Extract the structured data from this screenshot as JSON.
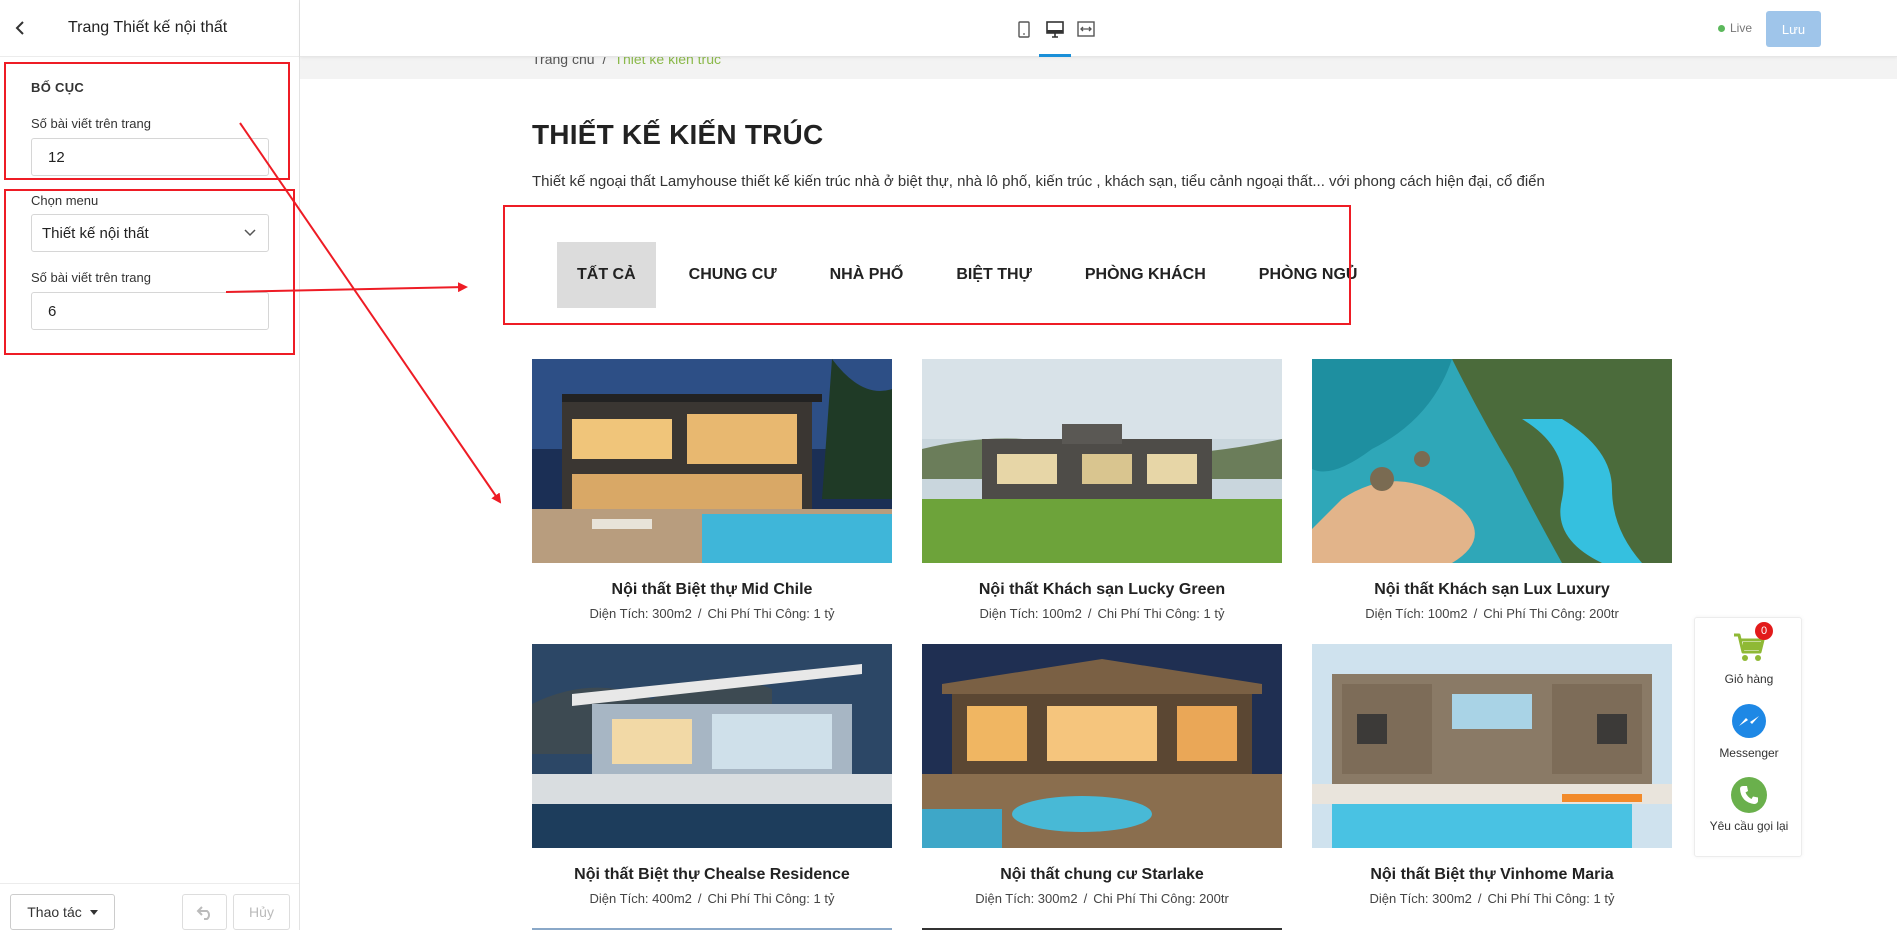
{
  "sidebar": {
    "title": "Trang Thiết kế nội thất",
    "section": "BỐ CỤC",
    "label_posts1": "Số bài viết trên trang",
    "posts1": "12",
    "label_menu": "Chọn menu",
    "menu_value": "Thiết kế nội thất",
    "label_posts2": "Số bài viết trên trang",
    "posts2": "6",
    "actions_label": "Thao tác",
    "cancel_label": "Hủy"
  },
  "topbar": {
    "live_label": "Live",
    "save_label": "Lưu"
  },
  "page": {
    "breadcrumb_home": "Trang chủ",
    "breadcrumb_sep": "/",
    "breadcrumb_current": "Thiết kế kiến trúc",
    "title": "THIẾT KẾ KIẾN TRÚC",
    "description": "Thiết kế ngoại thất Lamyhouse thiết kế kiến trúc nhà ở biệt thự, nhà lô phố, kiến trúc , khách sạn, tiểu cảnh ngoại thất... với phong cách hiện đại, cổ điển",
    "tabs": [
      "TẤT CẢ",
      "CHUNG CƯ",
      "NHÀ PHỐ",
      "BIỆT THỰ",
      "PHÒNG KHÁCH",
      "PHÒNG NGỦ"
    ],
    "meta_sep": "/",
    "cards": [
      {
        "title": "Nội thất Biệt thự Mid Chile",
        "area": "Diện Tích: 300m2",
        "cost": "Chi Phí Thi Công: 1 tỷ"
      },
      {
        "title": "Nội thất Khách sạn Lucky Green",
        "area": "Diện Tích: 100m2",
        "cost": "Chi Phí Thi Công: 1 tỷ"
      },
      {
        "title": "Nội thất Khách sạn Lux Luxury",
        "area": "Diện Tích: 100m2",
        "cost": "Chi Phí Thi Công: 200tr"
      },
      {
        "title": "Nội thất Biệt thự Chealse Residence",
        "area": "Diện Tích: 400m2",
        "cost": "Chi Phí Thi Công: 1 tỷ"
      },
      {
        "title": "Nội thất chung cư Starlake",
        "area": "Diện Tích: 300m2",
        "cost": "Chi Phí Thi Công: 200tr"
      },
      {
        "title": "Nội thất Biệt thự Vinhome Maria",
        "area": "Diện Tích: 300m2",
        "cost": "Chi Phí Thi Công: 1 tỷ"
      }
    ]
  },
  "floating": {
    "cart_label": "Giỏ hàng",
    "cart_count": "0",
    "messenger_label": "Messenger",
    "callback_label": "Yêu cầu gọi lại"
  },
  "icons": {
    "back": "chevron-left-icon",
    "mobile": "mobile-device-icon",
    "desktop": "desktop-device-icon",
    "fullwidth": "fullwidth-icon",
    "undo": "undo-icon",
    "cart": "cart-icon",
    "messenger": "messenger-icon",
    "phone": "phone-icon"
  },
  "colors": {
    "annotation": "#ee1c25",
    "accent": "#1a8fd8",
    "save_button": "#9fc5ea",
    "live_dot": "#5cb85c",
    "breadcrumb_current": "#8bb94a",
    "cart": "#8fb935",
    "messenger": "#1e88e5",
    "phone": "#6ab04c"
  }
}
